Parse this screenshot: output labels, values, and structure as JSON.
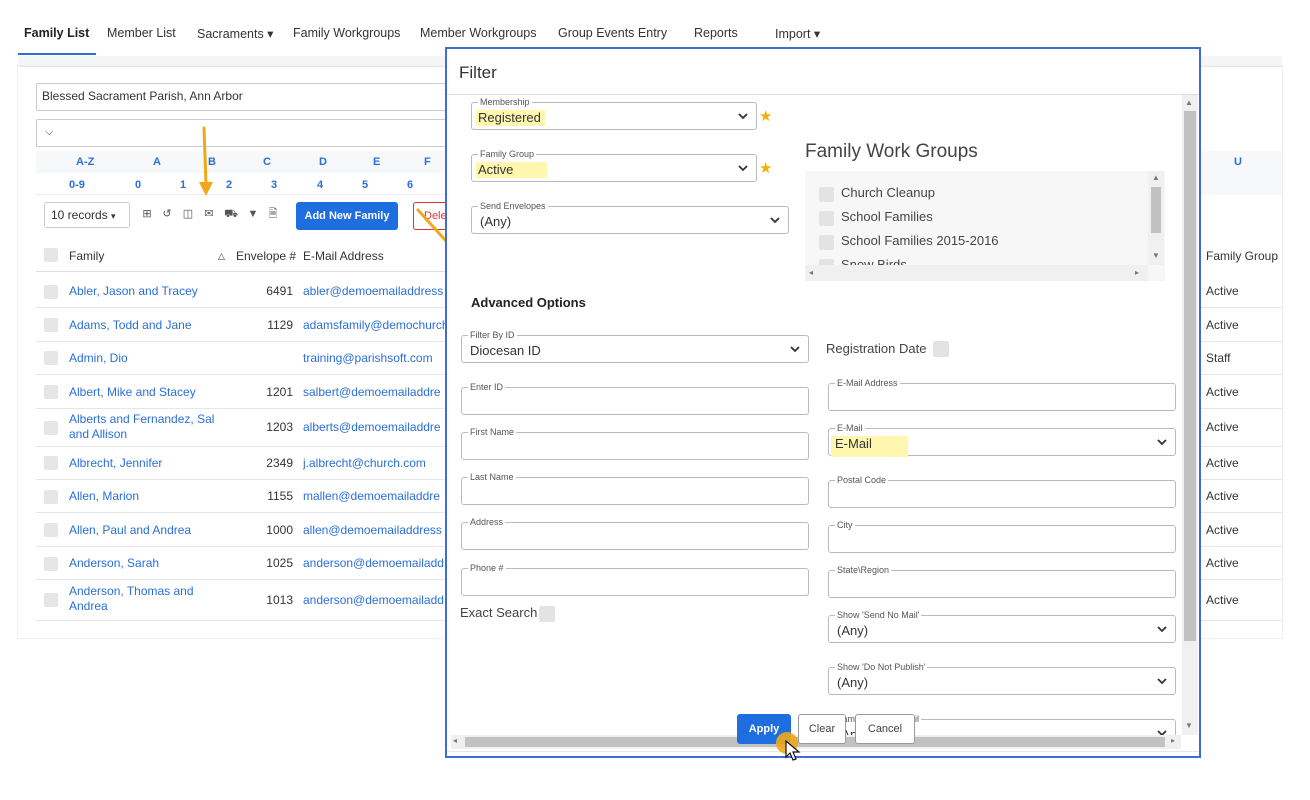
{
  "nav": {
    "tabs": [
      {
        "label": "Family List"
      },
      {
        "label": "Member List"
      },
      {
        "label": "Sacraments ▾"
      },
      {
        "label": "Family Workgroups"
      },
      {
        "label": "Member Workgroups"
      },
      {
        "label": "Group Events Entry"
      },
      {
        "label": "Reports"
      },
      {
        "label": "Import ▾"
      }
    ]
  },
  "page": {
    "parish": "Blessed Sacrament Parish, Ann Arbor",
    "alpha_row1": [
      "A-Z",
      "A",
      "B",
      "C",
      "D",
      "E",
      "F"
    ],
    "alpha_row2": [
      "0-9",
      "0",
      "1",
      "2",
      "3",
      "4",
      "5",
      "6"
    ],
    "alpha_right": "U",
    "records": "10 records",
    "add_new_label": "Add New Family",
    "delete_label": "Delete",
    "columns": {
      "family": "Family",
      "envelope": "Envelope #",
      "email": "E-Mail Address",
      "group": "Family Group"
    },
    "rows": [
      {
        "family": "Abler, Jason and Tracey",
        "envelope": "6491",
        "email": "abler@demoemailaddress",
        "group": "Active"
      },
      {
        "family": "Adams, Todd and Jane",
        "envelope": "1129",
        "email": "adamsfamily@demochurch",
        "group": "Active"
      },
      {
        "family": "Admin, Dio",
        "envelope": "",
        "email": "training@parishsoft.com",
        "group": "Staff"
      },
      {
        "family": "Albert, Mike and Stacey",
        "envelope": "1201",
        "email": "salbert@demoemailaddre",
        "group": "Active"
      },
      {
        "family": "Alberts and Fernandez, Sal and Allison",
        "envelope": "1203",
        "email": "alberts@demoemailaddre",
        "group": "Active"
      },
      {
        "family": "Albrecht, Jennifer",
        "envelope": "2349",
        "email": "j.albrecht@church.com",
        "group": "Active"
      },
      {
        "family": "Allen, Marion",
        "envelope": "1155",
        "email": "mallen@demoemailaddre",
        "group": "Active"
      },
      {
        "family": "Allen, Paul and Andrea",
        "envelope": "1000",
        "email": "allen@demoemailaddress",
        "group": "Active"
      },
      {
        "family": "Anderson, Sarah",
        "envelope": "1025",
        "email": "anderson@demoemailadd",
        "group": "Active"
      },
      {
        "family": "Anderson, Thomas and Andrea",
        "envelope": "1013",
        "email": "anderson@demoemailadd",
        "group": "Active"
      }
    ]
  },
  "filter": {
    "title": "Filter",
    "membership": {
      "label": "Membership",
      "value": "Registered"
    },
    "family_group": {
      "label": "Family Group",
      "value": "Active"
    },
    "send_envelopes": {
      "label": "Send Envelopes",
      "value": "(Any)"
    },
    "work_groups": {
      "title": "Family Work Groups",
      "items": [
        "Church Cleanup",
        "School Families",
        "School Families 2015-2016",
        "Snow Birds"
      ]
    },
    "advanced_label": "Advanced Options",
    "filter_by_id": {
      "label": "Filter By ID",
      "value": "Diocesan ID"
    },
    "enter_id": {
      "label": "Enter ID"
    },
    "first_name": {
      "label": "First Name"
    },
    "last_name": {
      "label": "Last Name"
    },
    "address": {
      "label": "Address"
    },
    "phone": {
      "label": "Phone #"
    },
    "exact_search": "Exact Search",
    "registration_date": "Registration Date",
    "email_address": {
      "label": "E-Mail Address"
    },
    "email_select": {
      "label": "E-Mail",
      "value": "E-Mail"
    },
    "postal_code": {
      "label": "Postal Code"
    },
    "city": {
      "label": "City"
    },
    "state_region": {
      "label": "State\\Region"
    },
    "send_no_mail": {
      "label": "Show 'Send No Mail'",
      "value": "(Any)"
    },
    "do_not_publish": {
      "label": "Show 'Do Not Publish'",
      "value": "(Any)"
    },
    "families_with_email": {
      "label": "Families With E-Mail",
      "value": "(Any)"
    },
    "buttons": {
      "apply": "Apply",
      "clear": "Clear",
      "cancel": "Cancel"
    }
  },
  "colors": {
    "accent": "#1f6ee0",
    "link": "#2a6fd6",
    "highlight": "#fff6b0",
    "star": "#f0b000",
    "arrow": "#f0a818",
    "modal_border": "#3e6bd8"
  }
}
